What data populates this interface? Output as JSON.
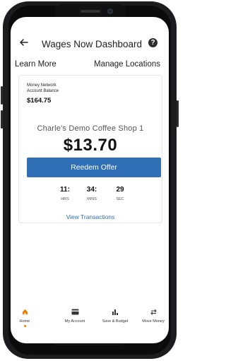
{
  "header": {
    "title": "Wages Now Dashboard",
    "back_icon": "arrow-left-icon",
    "help_icon": "question-icon",
    "help_glyph": "?"
  },
  "links": {
    "learn_more": "Learn More",
    "manage_locations": "Manage Locations"
  },
  "balance": {
    "label_line1": "Money Network",
    "label_line2": "Account Balance",
    "amount": "$164.75"
  },
  "offer": {
    "shop_name": "Charle's Demo Coffee Shop 1",
    "amount": "$13.70",
    "redeem_label": "Reedem Offer"
  },
  "timer": {
    "hours": "11:",
    "hours_unit": "HRS",
    "mins": "34:",
    "mins_unit": "MINS",
    "secs": "29",
    "secs_unit": "SEC"
  },
  "view_transactions": "View Transactions",
  "bottom_nav": {
    "items": [
      {
        "label": "Home",
        "icon": "home-icon"
      },
      {
        "label": "My Account",
        "icon": "card-icon"
      },
      {
        "label": "Save & Budget",
        "icon": "bar-chart-icon"
      },
      {
        "label": "Move Money",
        "icon": "transfer-icon"
      }
    ]
  },
  "colors": {
    "accent_blue": "#2f6fb6",
    "active_orange": "#ef7d00"
  }
}
